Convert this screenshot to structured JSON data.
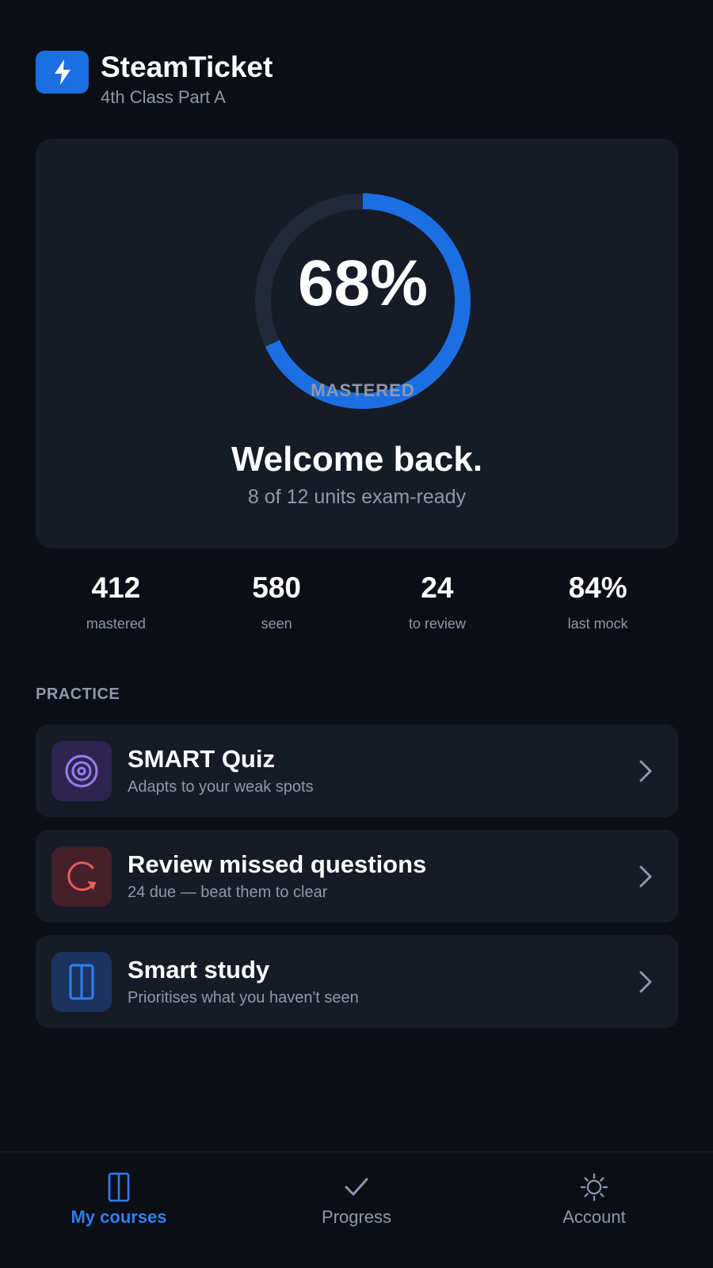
{
  "app": {
    "title": "SteamTicket",
    "subtitle": "4th Class Part A",
    "accent": "#1c6fe3"
  },
  "hero": {
    "progress_percent": 68,
    "percent_text": "68%",
    "ring_label": "MASTERED",
    "title": "Welcome back.",
    "subtitle": "8 of 12 units exam-ready"
  },
  "stats": [
    {
      "value": "412",
      "label": "mastered"
    },
    {
      "value": "580",
      "label": "seen"
    },
    {
      "value": "24",
      "label": "to review"
    },
    {
      "value": "84%",
      "label": "last mock"
    }
  ],
  "practice": {
    "section_title": "PRACTICE",
    "items": [
      {
        "title": "SMART Quiz",
        "subtitle": "Adapts to your weak spots",
        "icon": "target-icon",
        "color": "#8b5cf6"
      },
      {
        "title": "Review missed questions",
        "subtitle": "24 due — beat them to clear",
        "icon": "refresh-icon",
        "color": "#ef4444"
      },
      {
        "title": "Smart study",
        "subtitle": "Prioritises what you haven't seen",
        "icon": "book-icon",
        "color": "#2f7ff0"
      }
    ]
  },
  "nav": {
    "items": [
      {
        "label": "My courses",
        "icon": "book-icon",
        "active": true
      },
      {
        "label": "Progress",
        "icon": "check-icon",
        "active": false
      },
      {
        "label": "Account",
        "icon": "sun-icon",
        "active": false
      }
    ]
  }
}
